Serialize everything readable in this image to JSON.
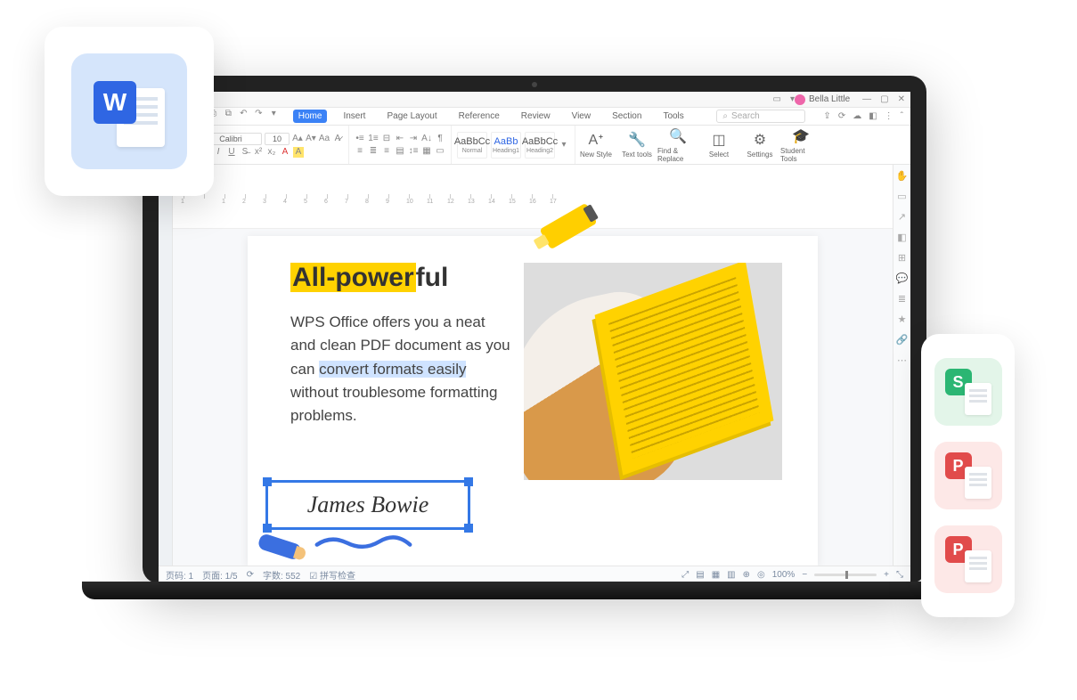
{
  "user": {
    "name": "Bella Little"
  },
  "window": {
    "minimize": "—",
    "maximize": "▢",
    "close": "✕"
  },
  "tabs": {
    "close": "✕",
    "add": "+"
  },
  "qat": {
    "save": "🖫",
    "print": "⎙",
    "preview": "⧉",
    "undo": "↶",
    "redo": "↷"
  },
  "menu": {
    "home": "Home",
    "insert": "Insert",
    "pageLayout": "Page Layout",
    "reference": "Reference",
    "review": "Review",
    "view": "View",
    "section": "Section",
    "tools": "Tools"
  },
  "search": {
    "placeholder": "Search"
  },
  "ribbon": {
    "font": "Calibri",
    "size": "10",
    "styles": {
      "normal": "Normal",
      "heading1": "Heading1",
      "heading2": "Heading2",
      "sample": "AaBbCc",
      "sampleBig": "AaBb"
    },
    "newStyle": "New Style",
    "textTools": "Text tools",
    "findReplace": "Find & Replace",
    "select": "Select",
    "settings": "Settings",
    "studentTools": "Student Tools"
  },
  "ruler": {
    "marks": [
      "1",
      "",
      "1",
      "2",
      "3",
      "4",
      "5",
      "6",
      "7",
      "8",
      "9",
      "10",
      "11",
      "12",
      "13",
      "14",
      "15",
      "16",
      "17"
    ]
  },
  "doc": {
    "titleHL": "All-power",
    "titleRest": "ful",
    "p1": "WPS Office offers you a neat and clean PDF document as you can ",
    "pSel": "convert formats easily",
    "p2": " without troublesome formatting problems.",
    "signature": "James Bowie"
  },
  "status": {
    "pageLabel": "页码: 1",
    "pagesLabel": "页面: 1/5",
    "wordsLabel": "字数: 552",
    "spellLabel": "拼写检查",
    "zoom": "100%"
  },
  "sideApps": {
    "s": "S",
    "p": "P",
    "p2": "P"
  },
  "wordApp": {
    "letter": "W"
  }
}
